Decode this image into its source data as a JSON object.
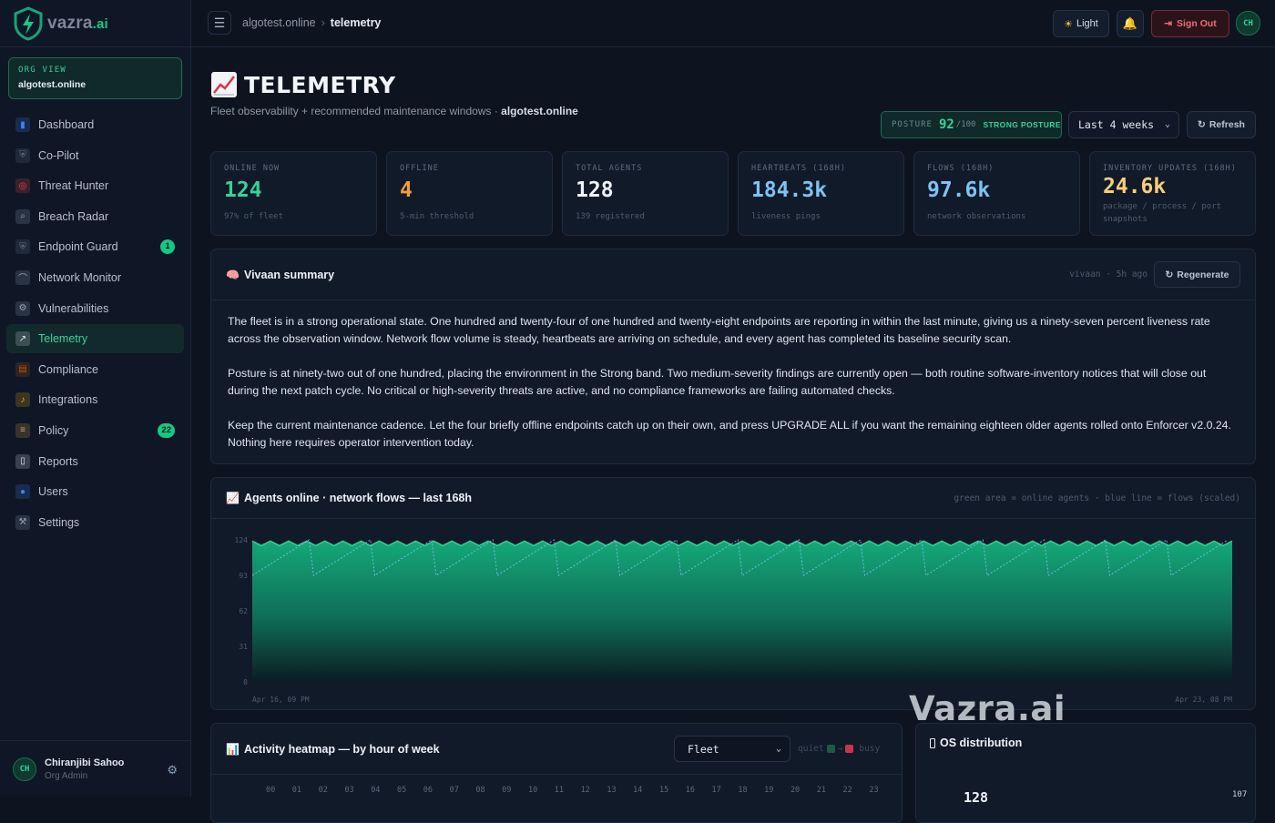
{
  "brand": {
    "name": "vazra",
    "suffix": ".ai",
    "color": "#16c784"
  },
  "org_view": {
    "label": "ORG VIEW",
    "value": "algotest.online"
  },
  "sidebar": {
    "items": [
      {
        "label": "Dashboard",
        "icon": "bar-chart-icon",
        "badge": ""
      },
      {
        "label": "Co-Pilot",
        "icon": "shield-icon",
        "badge": ""
      },
      {
        "label": "Threat Hunter",
        "icon": "target-icon",
        "badge": ""
      },
      {
        "label": "Breach Radar",
        "icon": "magnifier-icon",
        "badge": ""
      },
      {
        "label": "Endpoint Guard",
        "icon": "shield-icon",
        "badge": "1"
      },
      {
        "label": "Network Monitor",
        "icon": "satellite-dish-icon",
        "badge": ""
      },
      {
        "label": "Vulnerabilities",
        "icon": "bug-icon",
        "badge": ""
      },
      {
        "label": "Telemetry",
        "icon": "trend-chart-icon",
        "badge": "",
        "active": true
      },
      {
        "label": "Compliance",
        "icon": "clipboard-icon",
        "badge": ""
      },
      {
        "label": "Integrations",
        "icon": "bell-icon",
        "badge": ""
      },
      {
        "label": "Policy",
        "icon": "scroll-icon",
        "badge": "22"
      },
      {
        "label": "Reports",
        "icon": "document-icon",
        "badge": ""
      },
      {
        "label": "Users",
        "icon": "users-icon",
        "badge": ""
      },
      {
        "label": "Settings",
        "icon": "wrench-icon",
        "badge": ""
      }
    ]
  },
  "user": {
    "initials": "CH",
    "name": "Chiranjibi Sahoo",
    "role": "Org Admin"
  },
  "topbar": {
    "breadcrumb_root": "algotest.online",
    "breadcrumb_current": "telemetry",
    "theme_label": "Light",
    "signout_label": "Sign Out",
    "avatar_initials": "CH"
  },
  "page": {
    "title": "TELEMETRY",
    "subtitle": "Fleet observability + recommended maintenance windows · ",
    "subtitle_org": "algotest.online"
  },
  "posture": {
    "label": "POSTURE",
    "value": "92",
    "max": "/100",
    "band": "STRONG POSTURE"
  },
  "range": {
    "selected": "Last 4 weeks"
  },
  "refresh_label": "Refresh",
  "kpis": [
    {
      "label": "ONLINE NOW",
      "value": "124",
      "sub": "97% of fleet",
      "color": "#34d399"
    },
    {
      "label": "OFFLINE",
      "value": "4",
      "sub": "5-min threshold",
      "color": "#f59e3a"
    },
    {
      "label": "TOTAL AGENTS",
      "value": "128",
      "sub": "139 registered",
      "color": "#f1f5f9"
    },
    {
      "label": "HEARTBEATS (168H)",
      "value": "184.3k",
      "sub": "liveness pings",
      "color": "#7cc4f5"
    },
    {
      "label": "FLOWS (168H)",
      "value": "97.6k",
      "sub": "network observations",
      "color": "#7cc4f5"
    },
    {
      "label": "INVENTORY UPDATES (168H)",
      "value": "24.6k",
      "sub": "package / process / port snapshots",
      "color": "#f6cf7a"
    }
  ],
  "summary": {
    "title": "Vivaan summary",
    "meta": "vivaan · 5h ago",
    "regenerate_label": "Regenerate",
    "paragraphs": [
      "The fleet is in a strong operational state. One hundred and twenty-four of one hundred and twenty-eight endpoints are reporting in within the last minute, giving us a ninety-seven percent liveness rate across the observation window. Network flow volume is steady, heartbeats are arriving on schedule, and every agent has completed its baseline security scan.",
      "Posture is at ninety-two out of one hundred, placing the environment in the Strong band. Two medium-severity findings are currently open — both routine software-inventory notices that will close out during the next patch cycle. No critical or high-severity threats are active, and no compliance frameworks are failing automated checks.",
      "Keep the current maintenance cadence. Let the four briefly offline endpoints catch up on their own, and press UPGRADE ALL if you want the remaining eighteen older agents rolled onto Enforcer v2.0.24. Nothing here requires operator intervention today."
    ]
  },
  "agents_chart": {
    "title": "Agents online · network flows — last 168h",
    "legend": "green area = online agents · blue line = flows (scaled)"
  },
  "chart_data": {
    "type": "area",
    "y_ticks": [
      "124",
      "93",
      "62",
      "31",
      "0"
    ],
    "ylim": [
      0,
      124
    ],
    "x_start_label": "Apr 16, 09 PM",
    "x_end_label": "Apr 23, 08 PM",
    "series": [
      {
        "name": "online agents",
        "color": "#16a37a",
        "peaks": 54,
        "high": 124,
        "low": 119
      },
      {
        "name": "flows (scaled)",
        "color": "#7cc4f5",
        "cycles": 16,
        "high": 124,
        "low": 93
      }
    ]
  },
  "heatmap": {
    "title": "Activity heatmap — by hour of week",
    "scope_selected": "Fleet",
    "legend_quiet": "quiet",
    "legend_busy": "busy",
    "hours": [
      "00",
      "01",
      "02",
      "03",
      "04",
      "05",
      "06",
      "07",
      "08",
      "09",
      "10",
      "11",
      "12",
      "13",
      "14",
      "15",
      "16",
      "17",
      "18",
      "19",
      "20",
      "21",
      "22",
      "23"
    ]
  },
  "os_panel": {
    "title": "OS distribution",
    "value_left": "128",
    "value_right": "107"
  },
  "watermark": "Vazra.ai"
}
